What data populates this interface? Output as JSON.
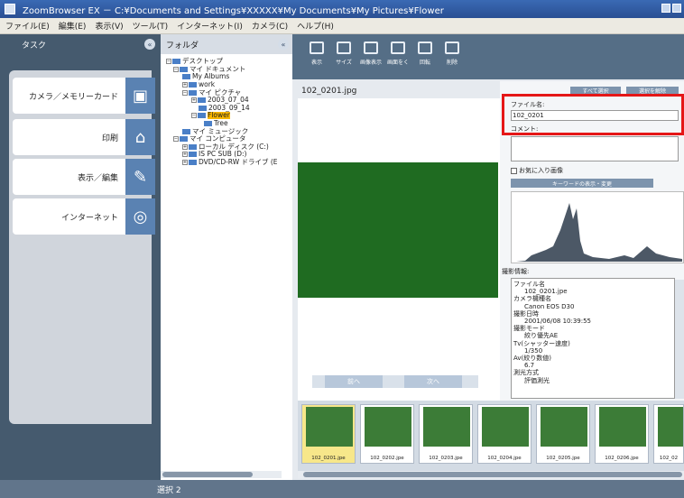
{
  "window": {
    "title": "ZoomBrowser EX － C:¥Documents and Settings¥XXXXX¥My Documents¥My Pictures¥Flower"
  },
  "menu": [
    "ファイル(E)",
    "編集(E)",
    "表示(V)",
    "ツール(T)",
    "インターネット(I)",
    "カメラ(C)",
    "ヘルプ(H)"
  ],
  "task": {
    "header": "タスク",
    "items": [
      "カメラ／メモリーカード",
      "印刷",
      "表示／編集",
      "インターネット"
    ]
  },
  "folder": {
    "header": "フォルダ",
    "items": [
      "デスクトップ",
      "マイ ドキュメント",
      "My Albums",
      "work",
      "マイ ピクチャ",
      "2003_07_04",
      "2003_09_14",
      "Flower",
      "Tree",
      "マイ ミュージック",
      "マイ コンピュータ",
      "ローカル ディスク (C:)",
      "IS PC SUB (D:)",
      "DVD/CD-RW ドライブ (E"
    ]
  },
  "toolbar": {
    "tools": [
      "表示",
      "サイズ",
      "画像表示",
      "画面をく",
      "回転",
      "削除"
    ]
  },
  "viewer": {
    "filename": "102_0201.jpg",
    "nav": [
      "前へ",
      "次へ"
    ]
  },
  "properties": {
    "buttons": [
      "すべて選択",
      "選択を解除"
    ],
    "filename_label": "ファイル名:",
    "filename_value": "102_0201",
    "comment_label": "コメント:",
    "favorite": "お気に入り画像",
    "keyword_button": "キーワードの表示・変更",
    "shooting_info_label": "撮影情報:",
    "info_lines": [
      "ファイル名",
      "102_0201.jpe",
      "カメラ機種名",
      "Canon EOS D30",
      "撮影日時",
      "2001/06/08 10:39:55",
      "撮影モード",
      "絞り優先AE",
      "Tv(シャッター速度)",
      "1/350",
      "Av(絞り数値)",
      "6.7",
      "測光方式",
      "評価測光"
    ]
  },
  "thumbnails": [
    "102_0201.jpe",
    "102_0202.jpe",
    "102_0203.jpe",
    "102_0204.jpe",
    "102_0205.jpe",
    "102_0206.jpe",
    "102_02"
  ],
  "status": "選択 2"
}
